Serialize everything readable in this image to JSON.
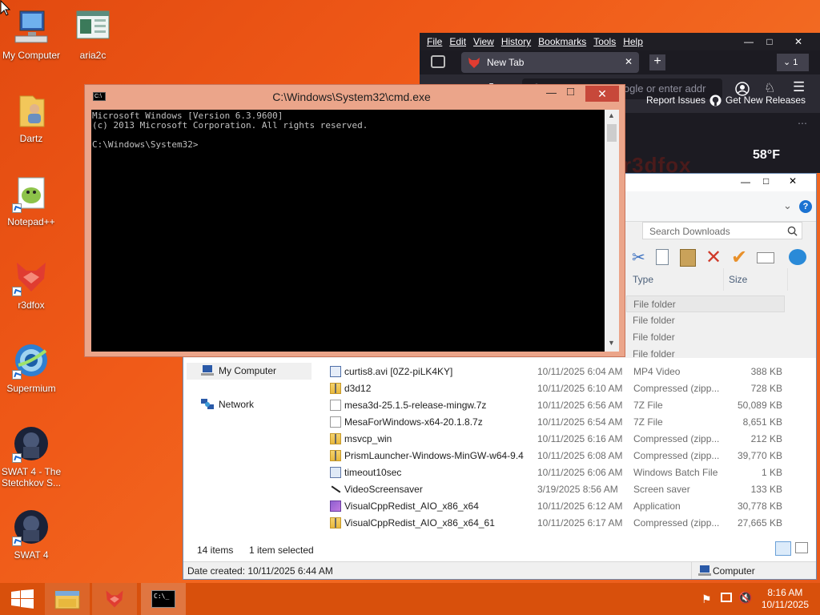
{
  "desktop": {
    "icons": [
      {
        "label": "My Computer"
      },
      {
        "label": "aria2c"
      },
      {
        "label": "Dartz"
      },
      {
        "label": "Notepad++"
      },
      {
        "label": "r3dfox"
      },
      {
        "label": "Supermium"
      },
      {
        "label": "SWAT 4 - The Stetchkov S..."
      },
      {
        "label": "SWAT 4"
      }
    ]
  },
  "browser": {
    "menu": [
      "File",
      "Edit",
      "View",
      "History",
      "Bookmarks",
      "Tools",
      "Help"
    ],
    "tab_title": "New Tab",
    "tab_count": "1",
    "url_placeholder": "Search with Google or enter addr",
    "bookmarks": [
      "Report Issues",
      "Get New Releases"
    ],
    "brand_text": "r3dfox",
    "weather": "58°F",
    "colors": {
      "bg": "#2b2a33",
      "accent": "#e03c31"
    }
  },
  "explorer": {
    "search_placeholder": "Search Downloads",
    "columns": {
      "type": "Type",
      "size": "Size"
    },
    "nav": [
      "My Computer",
      "Network"
    ],
    "folders": [
      {
        "type": "File folder"
      },
      {
        "type": "File folder"
      },
      {
        "type": "File folder"
      },
      {
        "type": "File folder"
      }
    ],
    "files": [
      {
        "name": "curtis8.avi [0Z2-piLK4KY]",
        "date": "10/11/2025 6:04 AM",
        "type": "MP4 Video",
        "size": "388 KB",
        "icon": "video-icon"
      },
      {
        "name": "d3d12",
        "date": "10/11/2025 6:10 AM",
        "type": "Compressed (zipp...",
        "size": "728 KB",
        "icon": "zip-icon"
      },
      {
        "name": "mesa3d-25.1.5-release-mingw.7z",
        "date": "10/11/2025 6:56 AM",
        "type": "7Z File",
        "size": "50,089 KB",
        "icon": "file-icon"
      },
      {
        "name": "MesaForWindows-x64-20.1.8.7z",
        "date": "10/11/2025 6:54 AM",
        "type": "7Z File",
        "size": "8,651 KB",
        "icon": "file-icon"
      },
      {
        "name": "msvcp_win",
        "date": "10/11/2025 6:16 AM",
        "type": "Compressed (zipp...",
        "size": "212 KB",
        "icon": "zip-icon"
      },
      {
        "name": "PrismLauncher-Windows-MinGW-w64-9.4",
        "date": "10/11/2025 6:08 AM",
        "type": "Compressed (zipp...",
        "size": "39,770 KB",
        "icon": "zip-icon"
      },
      {
        "name": "timeout10sec",
        "date": "10/11/2025 6:06 AM",
        "type": "Windows Batch File",
        "size": "1 KB",
        "icon": "batch-icon"
      },
      {
        "name": "VideoScreensaver",
        "date": "3/19/2025 8:56 AM",
        "type": "Screen saver",
        "size": "133 KB",
        "icon": "screensaver-icon"
      },
      {
        "name": "VisualCppRedist_AIO_x86_x64",
        "date": "10/11/2025 6:12 AM",
        "type": "Application",
        "size": "30,778 KB",
        "icon": "app-icon"
      },
      {
        "name": "VisualCppRedist_AIO_x86_x64_61",
        "date": "10/11/2025 6:17 AM",
        "type": "Compressed (zipp...",
        "size": "27,665 KB",
        "icon": "zip-icon"
      }
    ],
    "status_items": "14 items",
    "status_selected": "1 item selected",
    "details": "Date created: 10/11/2025 6:44 AM",
    "location": "Computer"
  },
  "cmd": {
    "title": "C:\\Windows\\System32\\cmd.exe",
    "lines": [
      "Microsoft Windows [Version 6.3.9600]",
      "(c) 2013 Microsoft Corporation. All rights reserved.",
      "",
      "C:\\Windows\\System32>"
    ]
  },
  "taskbar": {
    "time": "8:16 AM",
    "date": "10/11/2025"
  }
}
